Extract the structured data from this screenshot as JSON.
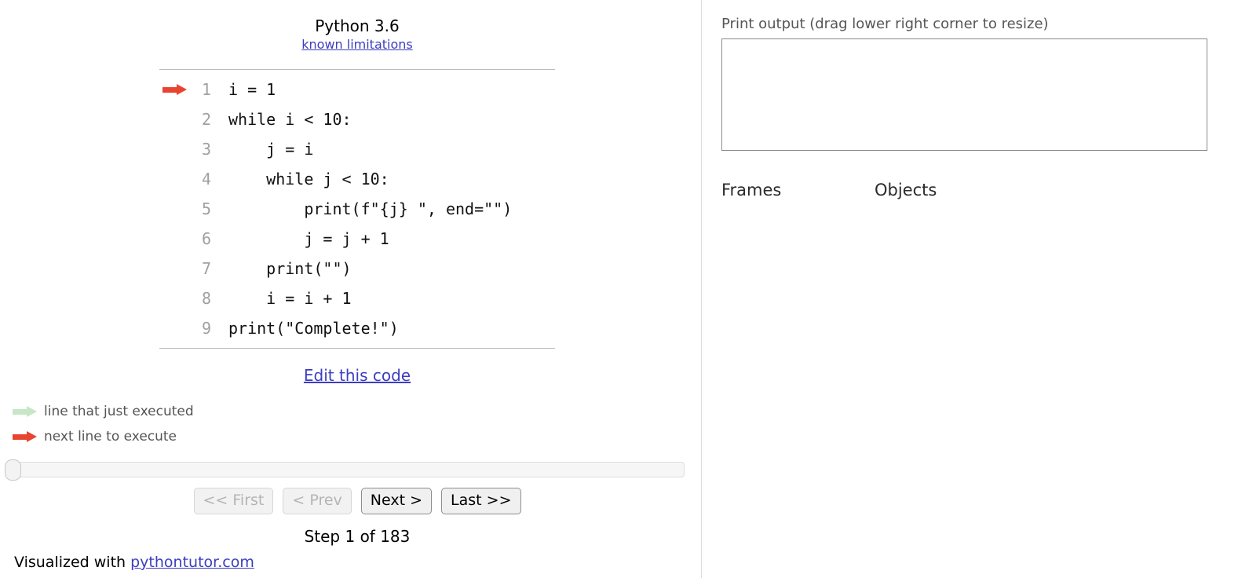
{
  "code_panel": {
    "python_version": "Python 3.6",
    "known_limitations_label": "known limitations",
    "edit_code_label": "Edit this code",
    "lines": [
      {
        "num": "1",
        "text": "i = 1",
        "arrow": "red"
      },
      {
        "num": "2",
        "text": "while i < 10:",
        "arrow": "none"
      },
      {
        "num": "3",
        "text": "    j = i",
        "arrow": "none"
      },
      {
        "num": "4",
        "text": "    while j < 10:",
        "arrow": "none"
      },
      {
        "num": "5",
        "text": "        print(f\"{j} \", end=\"\")",
        "arrow": "none"
      },
      {
        "num": "6",
        "text": "        j = j + 1",
        "arrow": "none"
      },
      {
        "num": "7",
        "text": "    print(\"\")",
        "arrow": "none"
      },
      {
        "num": "8",
        "text": "    i = i + 1",
        "arrow": "none"
      },
      {
        "num": "9",
        "text": "print(\"Complete!\")",
        "arrow": "none"
      }
    ]
  },
  "legend": {
    "just_executed_label": "line that just executed",
    "next_line_label": "next line to execute",
    "just_executed_color": "#c6e6c6",
    "next_line_color": "#e8442f"
  },
  "controls": {
    "first_label": "<< First",
    "prev_label": "< Prev",
    "next_label": "Next >",
    "last_label": "Last >>",
    "first_disabled": true,
    "prev_disabled": true,
    "step_text": "Step 1 of 183",
    "slider_position_percent": 0
  },
  "footer": {
    "visualized_prefix": "Visualized with ",
    "site_link_label": "pythontutor.com"
  },
  "output_panel": {
    "print_output_label": "Print output (drag lower right corner to resize)",
    "print_output_value": "",
    "frames_label": "Frames",
    "objects_label": "Objects"
  }
}
